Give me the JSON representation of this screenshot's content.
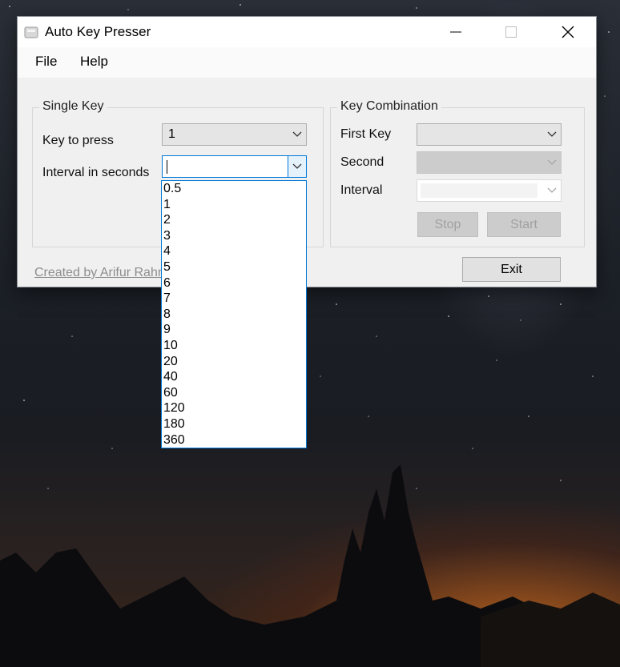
{
  "window": {
    "title": "Auto Key Presser",
    "menu": [
      "File",
      "Help"
    ]
  },
  "single_key": {
    "group_title": "Single Key",
    "key_label": "Key to press",
    "key_value": "1",
    "interval_label": "Interval in seconds",
    "interval_value": "",
    "interval_options": [
      "0.5",
      "1",
      "2",
      "3",
      "4",
      "5",
      "6",
      "7",
      "8",
      "9",
      "10",
      "20",
      "40",
      "60",
      "120",
      "180",
      "360"
    ]
  },
  "key_combination": {
    "group_title": "Key Combination",
    "first_key_label": "First Key",
    "second_label": "Second",
    "interval_label": "Interval",
    "stop_label": "Stop",
    "start_label": "Start"
  },
  "footer": {
    "credit_text": "Created by Arifur Rahm",
    "exit_label": "Exit"
  },
  "colors": {
    "accent": "#0078d7",
    "window_bg": "#f0f0f0",
    "disabled_bg": "#cccccc"
  },
  "icons": [
    "app-icon",
    "minimize-icon",
    "maximize-icon",
    "close-icon",
    "chevron-down-icon"
  ]
}
